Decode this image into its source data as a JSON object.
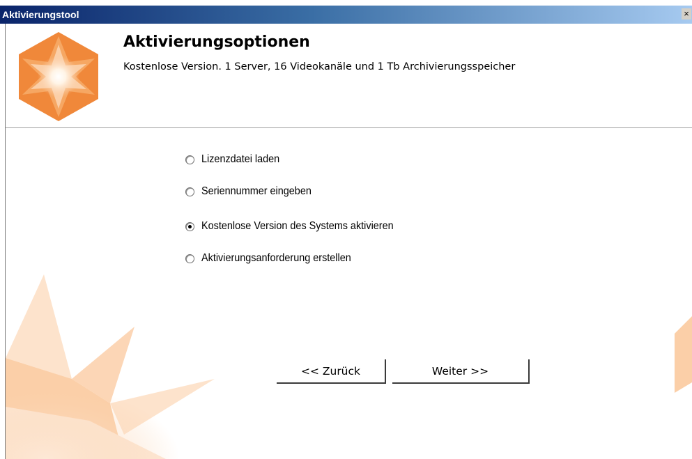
{
  "window": {
    "title": "Aktivierungstool",
    "close_glyph": "×"
  },
  "header": {
    "title": "Aktivierungsoptionen",
    "subtitle": "Kostenlose Version. 1 Server, 16 Videokanäle und 1 Tb Archivierungsspeicher",
    "logo_icon": "star-hexagon-logo-icon"
  },
  "options": [
    {
      "label": "Lizenzdatei laden",
      "checked": false
    },
    {
      "label": "Seriennummer eingeben",
      "checked": false
    },
    {
      "label": "Kostenlose Version des Systems aktivieren",
      "checked": true
    },
    {
      "label": "Aktivierungsanforderung erstellen",
      "checked": false
    }
  ],
  "buttons": {
    "back_label": "<< Zurück",
    "next_label": "Weiter >>"
  },
  "colors": {
    "accent_orange": "#f0883a",
    "light_orange": "#fbcfa8"
  }
}
